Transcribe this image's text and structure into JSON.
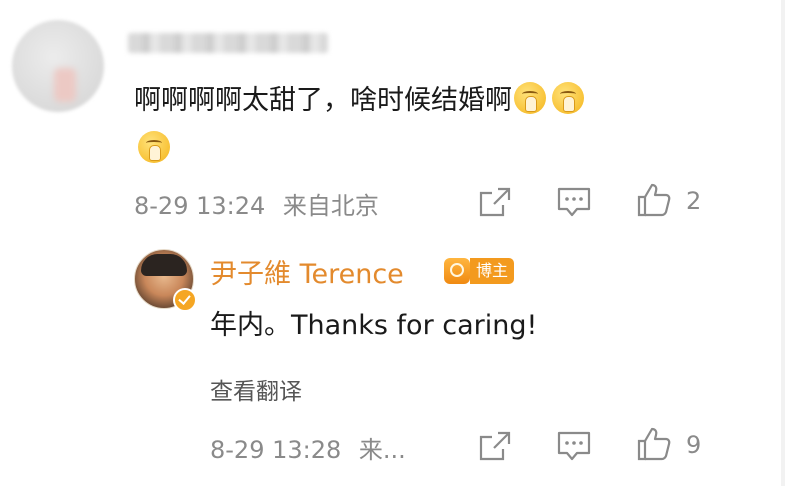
{
  "comment": {
    "text": "啊啊啊啊太甜了，啥时候结婚啊",
    "emojis": [
      "pray-emoji",
      "pray-emoji",
      "pray-emoji"
    ],
    "timestamp": "8-29 13:24",
    "location": "来自北京",
    "like_count": "2"
  },
  "reply": {
    "author_name": "尹子維 Terence",
    "role_badge": "博主",
    "text": "年内。Thanks for caring!",
    "translate_label": "查看翻译",
    "timestamp": "8-29 13:28",
    "location_truncated": "来...",
    "like_count": "9"
  },
  "colors": {
    "author_name": "#e38a2d",
    "badge": "#f39a1e",
    "meta_text": "#8a8a8a",
    "body_text": "#1a1a1a"
  }
}
